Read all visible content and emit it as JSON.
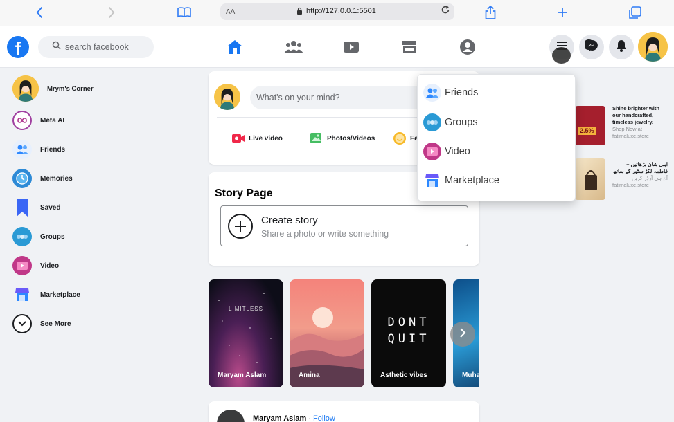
{
  "browser": {
    "aa_label": "AA",
    "url": "http://127.0.0.1:5501"
  },
  "header": {
    "logo_letter": "f",
    "search_placeholder": "search facebook"
  },
  "sidebar": {
    "profile_name": "Mrym's Corner",
    "items": [
      {
        "label": "Meta AI",
        "icon": "meta-ai-icon"
      },
      {
        "label": "Friends",
        "icon": "friends-icon"
      },
      {
        "label": "Memories",
        "icon": "clock-icon"
      },
      {
        "label": "Saved",
        "icon": "bookmark-icon"
      },
      {
        "label": "Groups",
        "icon": "groups-icon"
      },
      {
        "label": "Video",
        "icon": "video-icon"
      },
      {
        "label": "Marketplace",
        "icon": "shop-icon"
      },
      {
        "label": "See More",
        "icon": "chevron-down-icon"
      }
    ]
  },
  "composer": {
    "placeholder": "What's on your mind?",
    "actions": [
      {
        "label": "Live video",
        "color": "#f02849"
      },
      {
        "label": "Photos/Videos",
        "color": "#45bd62"
      },
      {
        "label": "Fe",
        "color": "#f7b928"
      }
    ]
  },
  "story_page": {
    "title": "Story Page",
    "create_title": "Create story",
    "create_sub": "Share a photo or write something",
    "stories": [
      {
        "name": "Maryam Aslam",
        "art_text": "LIMITLESS"
      },
      {
        "name": "Amina",
        "art_text": ""
      },
      {
        "name": "Asthetic vibes",
        "art_text": "DONT QUIT"
      },
      {
        "name": "Muha",
        "art_text": ""
      }
    ]
  },
  "post": {
    "author": "Maryam Aslam",
    "separator": "·",
    "follow": "Follow"
  },
  "sponsored": {
    "heading_fragment": "ed",
    "ads": [
      {
        "text": "Shine brighter with our handcrafted, timeless jewelry.",
        "cta": "Shop Now at",
        "source": "fatimaluxe.store",
        "badge": "2.5%"
      },
      {
        "text": "اپنی شان بڑھائیں – فاطمہ لکژ سٹور کے ساتھ",
        "cta": "آج ہی آرڈر کریں",
        "source": "fatimaluxe.store"
      }
    ]
  },
  "dropdown": {
    "items": [
      {
        "label": "Friends"
      },
      {
        "label": "Groups"
      },
      {
        "label": "Video"
      },
      {
        "label": "Marketplace"
      }
    ]
  },
  "colors": {
    "accent": "#1877f2",
    "page_bg": "#f0f2f5"
  }
}
